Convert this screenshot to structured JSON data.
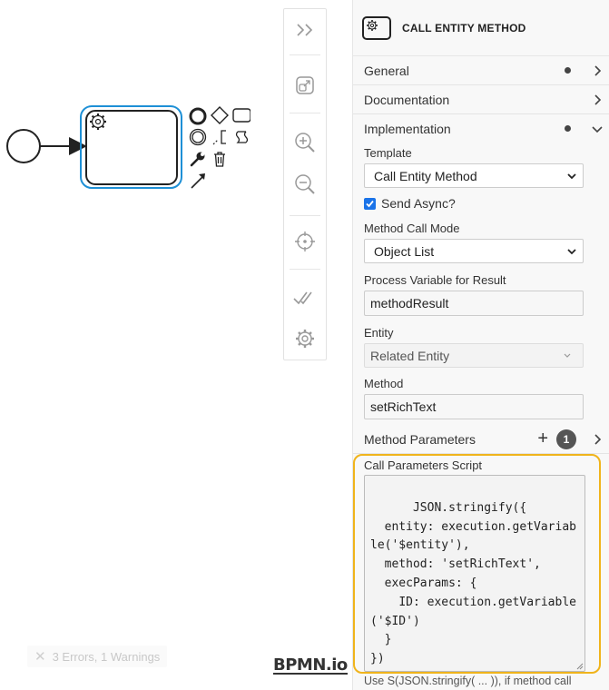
{
  "toolbar": {
    "items": [
      "toggle-panel-icon",
      "fit-viewport-icon",
      "zoom-in-icon",
      "zoom-out-icon",
      "reset-view-icon",
      "validate-icon",
      "settings-icon"
    ]
  },
  "canvas": {
    "context_pad": [
      "end-event-icon",
      "gateway-icon",
      "task-icon",
      "intermediate-event-icon",
      "text-annotation-icon",
      "append-more-icon",
      "wrench-icon",
      "trash-icon",
      "connect-arrow-icon"
    ]
  },
  "linting": {
    "text": "3 Errors, 1 Warnings"
  },
  "brand": {
    "logo": "BPMN.io"
  },
  "panel": {
    "header_title": "CALL ENTITY METHOD",
    "groups": {
      "general": "General",
      "documentation": "Documentation",
      "implementation": "Implementation"
    },
    "template": {
      "label": "Template",
      "value": "Call Entity Method"
    },
    "send_async": {
      "label": "Send Async?",
      "checked": true
    },
    "method_call_mode": {
      "label": "Method Call Mode",
      "value": "Object List"
    },
    "result_var": {
      "label": "Process Variable for Result",
      "value": "methodResult"
    },
    "entity": {
      "label": "Entity",
      "value": "Related Entity"
    },
    "method": {
      "label": "Method",
      "value": "setRichText"
    },
    "method_parameters": {
      "label": "Method Parameters",
      "count": "1"
    },
    "call_params_script": {
      "label": "Call Parameters Script",
      "value": "JSON.stringify({\n  entity: execution.getVariable('$entity'),\n  method: 'setRichText',\n  execParams: {\n    ID: execution.getVariable('$ID')\n  }\n})"
    },
    "hint": "Use S(JSON.stringify( ... )), if method call"
  },
  "colors": {
    "selection": "#1e90d6",
    "highlight": "#f0b41c",
    "checkbox": "#1a73e8"
  }
}
